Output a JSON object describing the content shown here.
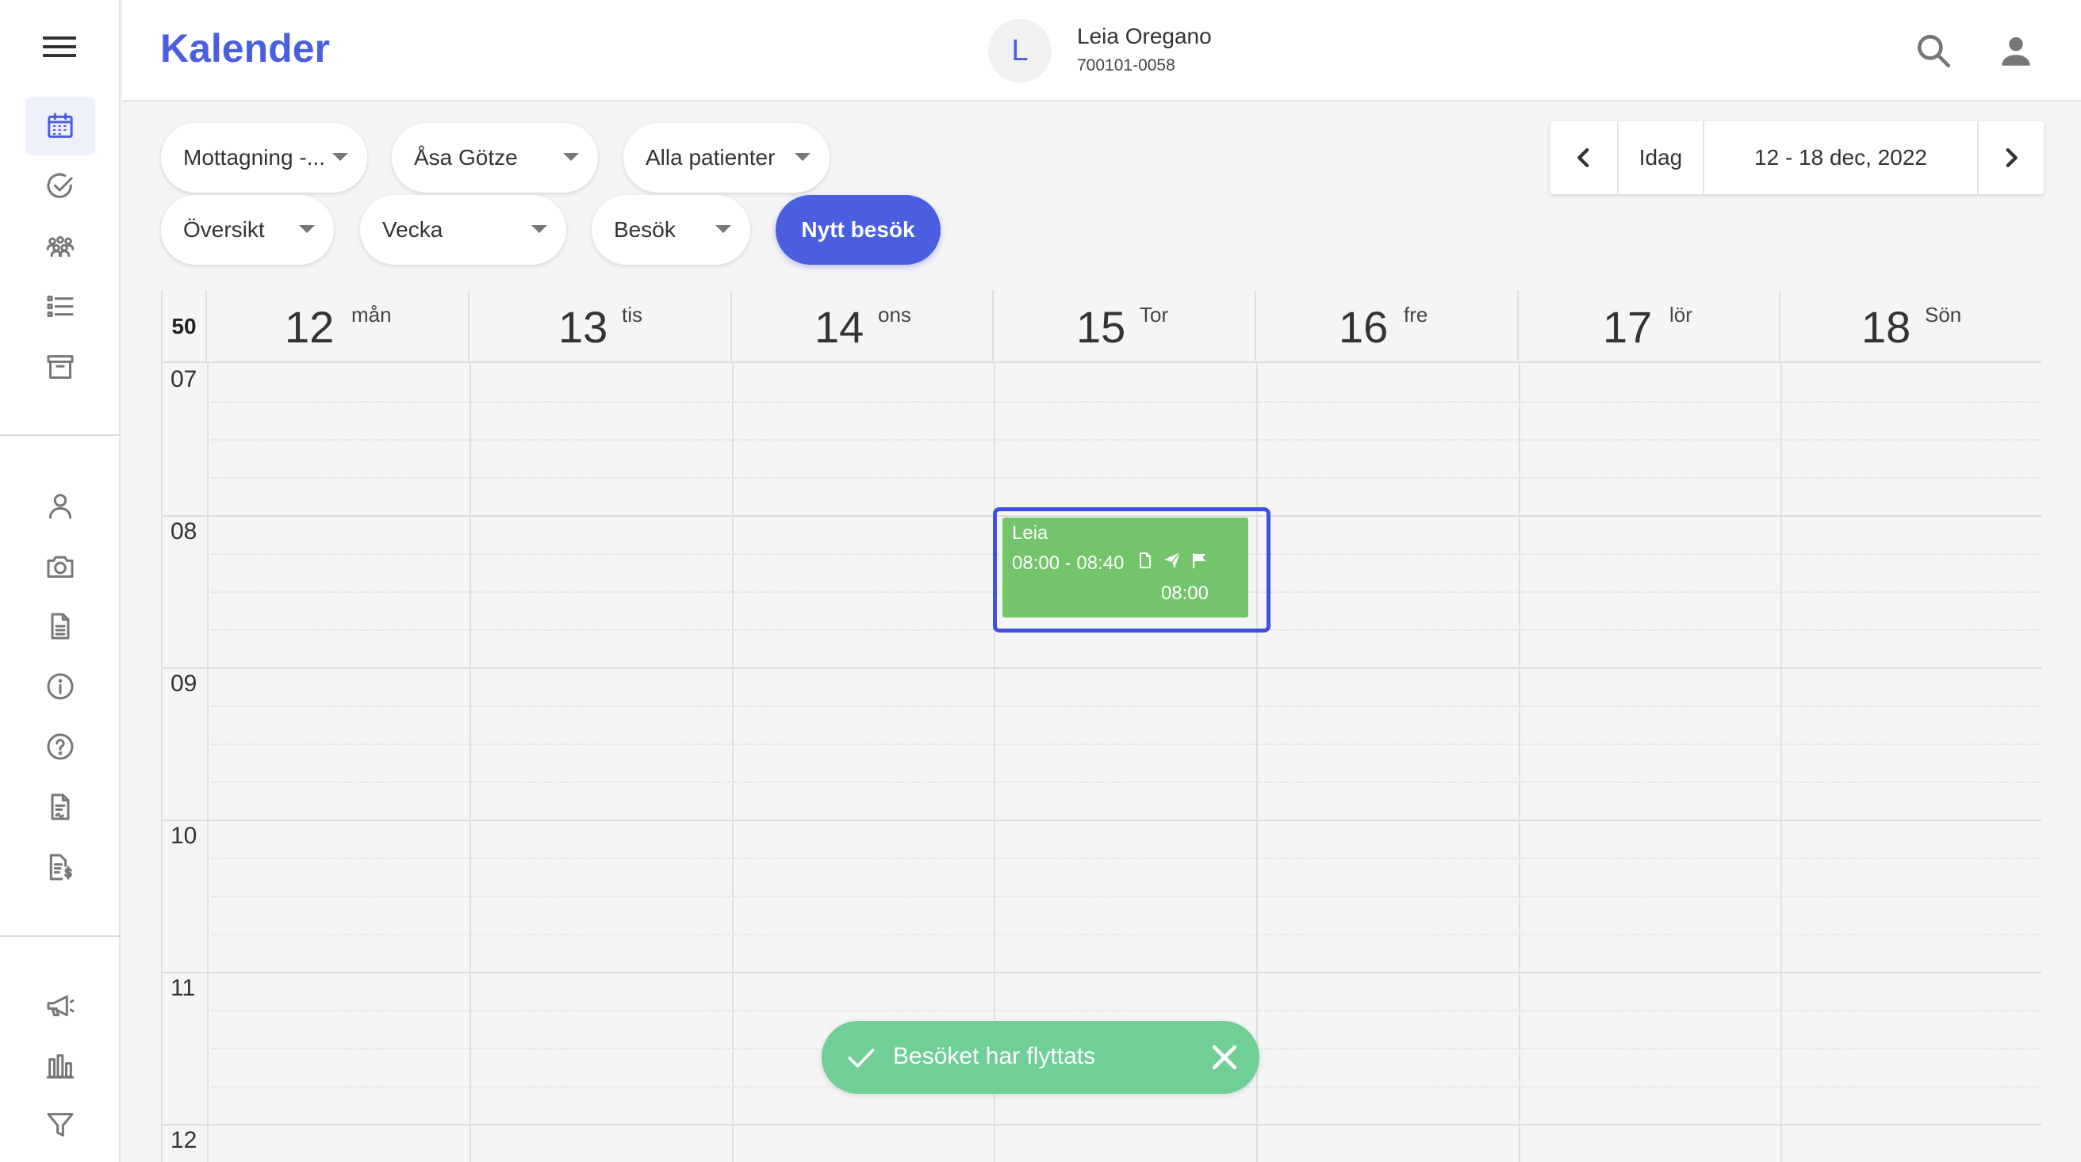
{
  "app": {
    "title": "Kalender"
  },
  "patient": {
    "initial": "L",
    "name": "Leia Oregano",
    "id": "700101-0058"
  },
  "colors": {
    "accent": "#4a5fe0",
    "event": "#74c46c",
    "toast": "#6fcf97"
  },
  "sidebar": {
    "items": [
      {
        "name": "calendar-icon",
        "active": true
      },
      {
        "name": "check-circle-icon"
      },
      {
        "name": "group-icon"
      },
      {
        "name": "list-icon"
      },
      {
        "name": "archive-icon"
      },
      {
        "name": "person-icon"
      },
      {
        "name": "camera-icon"
      },
      {
        "name": "document-icon"
      },
      {
        "name": "info-icon"
      },
      {
        "name": "help-icon"
      },
      {
        "name": "form-icon"
      },
      {
        "name": "invoice-icon"
      },
      {
        "name": "megaphone-icon"
      },
      {
        "name": "bar-chart-icon"
      },
      {
        "name": "filter-icon"
      }
    ]
  },
  "filters": {
    "reception": "Mottagning -...",
    "practitioner": "Åsa Götze",
    "patients": "Alla patienter",
    "view": "Översikt",
    "range": "Vecka",
    "type": "Besök",
    "new_visit": "Nytt besök"
  },
  "datenav": {
    "today": "Idag",
    "range": "12 - 18 dec, 2022"
  },
  "calendar": {
    "week_number": "50",
    "days": [
      {
        "num": "12",
        "weekday": "mån"
      },
      {
        "num": "13",
        "weekday": "tis"
      },
      {
        "num": "14",
        "weekday": "ons"
      },
      {
        "num": "15",
        "weekday": "Tor"
      },
      {
        "num": "16",
        "weekday": "fre"
      },
      {
        "num": "17",
        "weekday": "lör"
      },
      {
        "num": "18",
        "weekday": "Sön"
      }
    ],
    "hours": [
      "07",
      "08",
      "09",
      "10",
      "11",
      "12"
    ]
  },
  "event": {
    "name": "Leia",
    "time": "08:00 - 08:40",
    "start": "08:00"
  },
  "toast": {
    "message": "Besöket har flyttats"
  }
}
